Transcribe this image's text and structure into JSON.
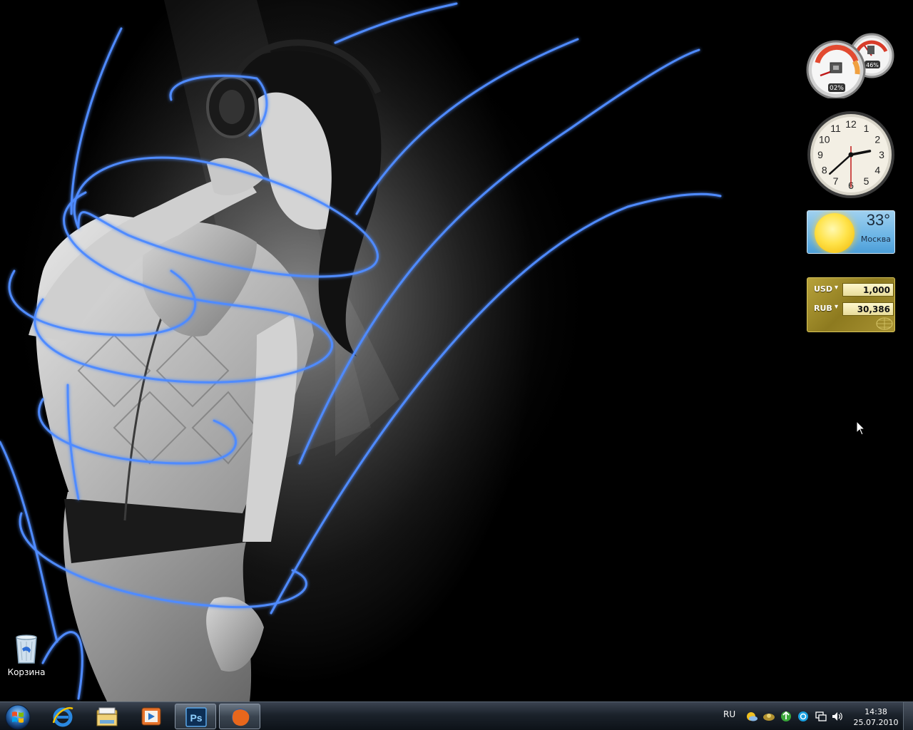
{
  "desktop": {
    "icons": [
      {
        "label": "Корзина",
        "icon": "recycle-bin-icon"
      }
    ]
  },
  "gadgets": {
    "cpu_meter": {
      "cpu_percent": "02%",
      "memory_percent": "46%"
    },
    "clock": {
      "time": "14:38",
      "numbers": [
        "12",
        "1",
        "2",
        "3",
        "4",
        "5",
        "6",
        "7",
        "8",
        "9",
        "10",
        "11"
      ]
    },
    "weather": {
      "temperature": "33°",
      "city": "Москва",
      "condition": "sun-icon"
    },
    "currency": {
      "rows": [
        {
          "code": "USD",
          "value": "1,000"
        },
        {
          "code": "RUB",
          "value": "30,386"
        }
      ]
    }
  },
  "taskbar": {
    "start": "windows-start-icon",
    "pinned": [
      "internet-explorer-icon",
      "windows-explorer-icon",
      "media-player-icon",
      "photoshop-icon",
      "firefox-icon"
    ],
    "photoshop_label": "Ps",
    "language": "RU",
    "tray_icons": [
      "weather-tray-icon",
      "network-tray-icon",
      "utorrent-tray-icon",
      "skype-tray-icon",
      "action-center-icon",
      "volume-icon"
    ],
    "time": "14:38",
    "date": "25.07.2010"
  },
  "colors": {
    "wallpaper_glow": "#3d7bff",
    "taskbar": "#1b222b"
  }
}
